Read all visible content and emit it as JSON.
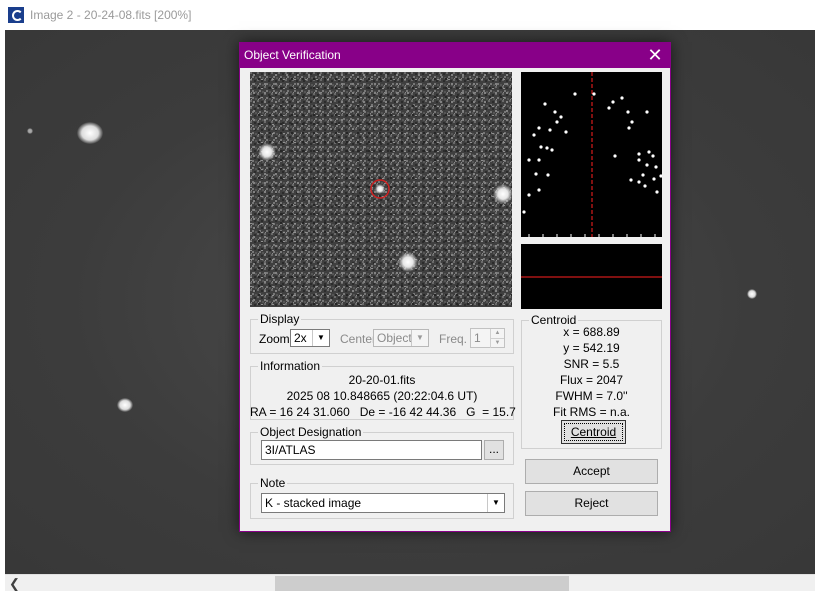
{
  "background_window": {
    "title": "Image 2 - 20-24-08.fits [200%]",
    "icon": "app-icon"
  },
  "dialog": {
    "title": "Object Verification",
    "close_icon": "close-icon"
  },
  "display": {
    "legend": "Display",
    "zoom_label": "Zoom",
    "zoom_value": "2x",
    "center_label": "Center",
    "center_value": "Object",
    "freq_label": "Freq.",
    "freq_value": "1"
  },
  "information": {
    "legend": "Information",
    "file": "20-20-01.fits",
    "date": "2025 08 10.848665 (20:22:04.6 UT)",
    "coords": "RA = 16 24 31.060   De = -16 42 44.36   G  = 15.7"
  },
  "designation": {
    "legend": "Object Designation",
    "value": "3I/ATLAS",
    "browse_label": "..."
  },
  "note": {
    "legend": "Note",
    "value": "K - stacked image"
  },
  "centroid": {
    "legend": "Centroid",
    "lines": [
      "x = 688.89",
      "y = 542.19",
      "SNR = 5.5",
      "Flux = 2047",
      "FWHM = 7.0''",
      "Fit RMS = n.a."
    ],
    "button_label": "Centroid"
  },
  "buttons": {
    "accept": "Accept",
    "reject": "Reject"
  },
  "colors": {
    "title_bar": "#880088",
    "marker": "#cc2222",
    "crosshair": "#ff2020"
  }
}
